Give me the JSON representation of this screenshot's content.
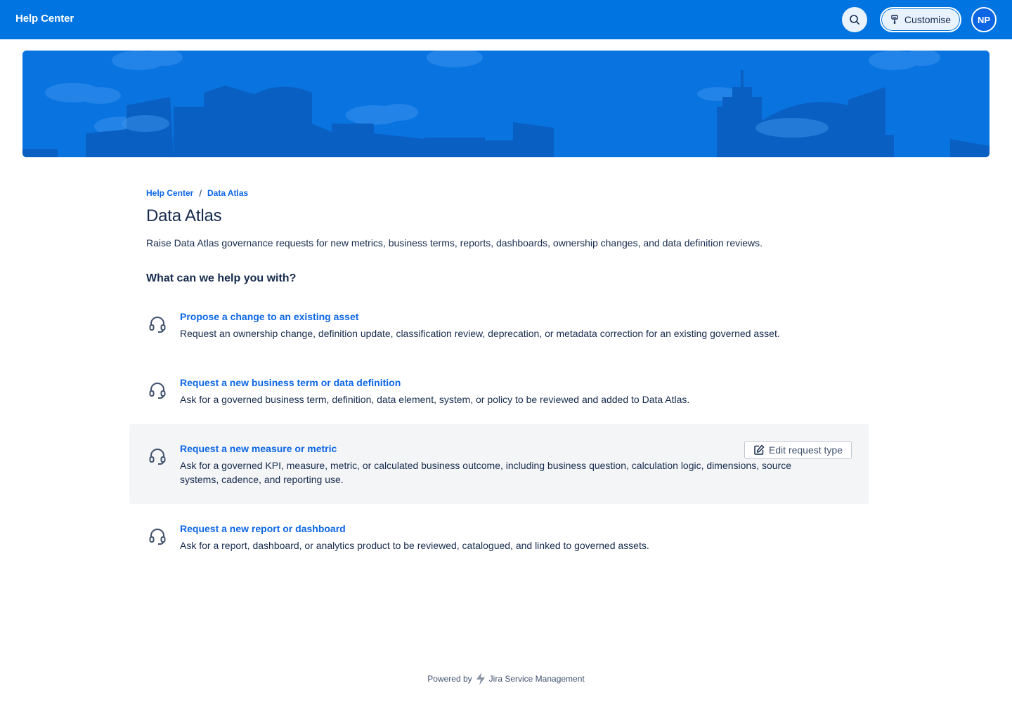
{
  "topbar": {
    "brand": "Help Center",
    "search_icon": "search-icon",
    "customise_label": "Customise",
    "customise_icon": "paintbrush-icon",
    "avatar_initials": "NP"
  },
  "breadcrumb": {
    "items": [
      "Help Center",
      "Data Atlas"
    ],
    "separator": "/"
  },
  "page": {
    "title": "Data Atlas",
    "description": "Raise Data Atlas governance requests for new metrics, business terms, reports, dashboards, ownership changes, and data definition reviews.",
    "section_heading": "What can we help you with?"
  },
  "requests": [
    {
      "title": "Propose a change to an existing asset",
      "description": "Request an ownership change, definition update, classification review, deprecation, or metadata correction for an existing governed asset.",
      "icon": "headset-icon"
    },
    {
      "title": "Request a new business term or data definition",
      "description": "Ask for a governed business term, definition, data element, system, or policy to be reviewed and added to Data Atlas.",
      "icon": "headset-icon"
    },
    {
      "title": "Request a new measure or metric",
      "description": "Ask for a governed KPI, measure, metric, or calculated business outcome, including business question, calculation logic, dimensions, source systems, cadence, and reporting use.",
      "icon": "headset-icon",
      "edit_label": "Edit request type"
    },
    {
      "title": "Request a new report or dashboard",
      "description": "Ask for a report, dashboard, or analytics product to be reviewed, catalogued, and linked to governed assets.",
      "icon": "headset-icon"
    }
  ],
  "footer": {
    "prefix": "Powered by",
    "product": "Jira Service Management"
  },
  "colors": {
    "topbar": "#0074e0",
    "link": "#0c66e4",
    "text": "#172b4d",
    "hover_row": "#f4f5f7"
  }
}
